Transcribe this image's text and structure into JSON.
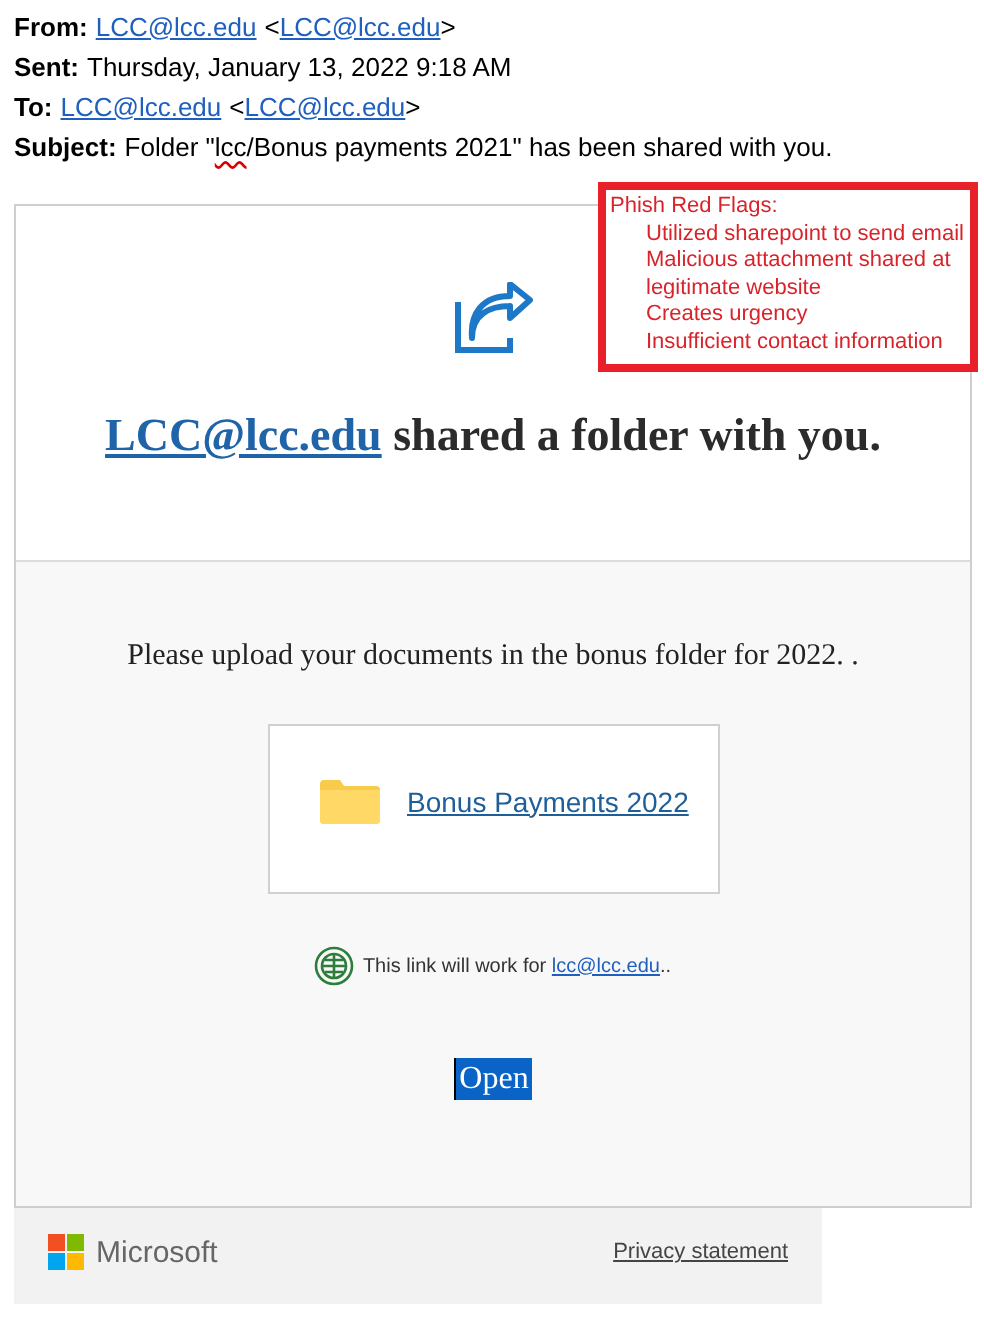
{
  "header": {
    "from": {
      "label": "From:",
      "name": "LCC@lcc.edu",
      "address_open": "<",
      "address": "LCC@lcc.edu",
      "address_close": ">"
    },
    "sent": {
      "label": "Sent:",
      "value": "Thursday, January 13, 2022 9:18 AM"
    },
    "to": {
      "label": "To:",
      "name": "LCC@lcc.edu",
      "address_open": "<",
      "address": "LCC@lcc.edu",
      "address_close": ">"
    },
    "subject": {
      "label": "Subject:",
      "parts": [
        {
          "text": "Folder \"",
          "misspelled": false
        },
        {
          "text": "lcc",
          "misspelled": true
        },
        {
          "text": "/Bonus payments 2021\" has been shared with you.",
          "misspelled": false
        }
      ]
    }
  },
  "red_flags": {
    "title": "Phish Red Flags:",
    "items": [
      "Utilized sharepoint to send email",
      "Malicious attachment shared at legitimate website",
      "Creates urgency",
      "Insufficient contact information"
    ]
  },
  "share_card": {
    "sender_link": "LCC@lcc.edu",
    "heading_rest": " shared a folder with you.",
    "message": "Please upload your documents in the bonus folder for 2022. .",
    "folder_name": "Bonus Payments 2022",
    "link_note": "This link will work for ",
    "link_note_address": "lcc@lcc.edu",
    "link_note_end": "..",
    "open_button": {
      "label": "Open",
      "selected": true
    }
  },
  "footer": {
    "brand": "Microsoft",
    "privacy_link": "Privacy statement"
  }
}
